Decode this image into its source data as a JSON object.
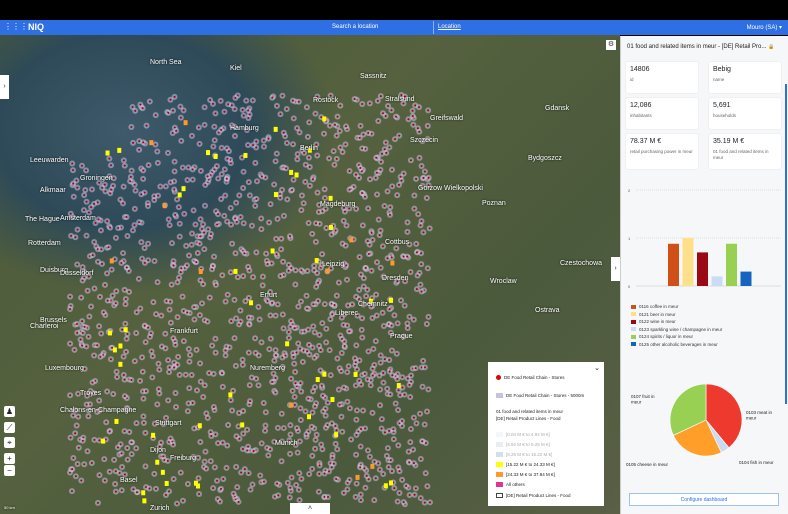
{
  "nav": {
    "app_name": "NIQ",
    "search_placeholder": "Search a location",
    "location_link": "Location",
    "user": "Mouro (SA) ▾",
    "grid_icon": "⋮⋮⋮"
  },
  "map": {
    "cities": [
      "North Sea",
      "Berlin",
      "Hamburg",
      "Rostock",
      "Gdansk",
      "Szczecin",
      "Bydgoszcz",
      "Poznan",
      "Leeuwarden",
      "Groningen",
      "Alkmaar",
      "The Hague",
      "Rotterdam",
      "Amsterdam",
      "Duisburg",
      "Dusseldorf",
      "Gorzow Wielkopolski",
      "Magdeburg",
      "Leipzig",
      "Dresden",
      "Chemnitz",
      "Wroclaw",
      "Prague",
      "Brussels",
      "Charleroi",
      "Luxembourg",
      "Frankfurt",
      "Nuremberg",
      "Stuttgart",
      "Munich",
      "Freiburg",
      "Basel",
      "Zurich",
      "Ostrava",
      "Czestochowa",
      "Liberec",
      "Erfurt",
      "Cottbus",
      "Kiel",
      "Sassnitz",
      "Stralsund",
      "Greifswald",
      "Troyes",
      "Chalons-en-Champagne",
      "Dijon"
    ],
    "controls": {
      "person": "♟",
      "ruler": "⟋",
      "locate": "⌖",
      "zoom_in": "+",
      "zoom_out": "−",
      "expand_left": "›",
      "expand_right": "›",
      "expand_bottom": "˄",
      "scale": "50 km"
    }
  },
  "legend": {
    "collapse": "⌄",
    "items": [
      {
        "label": "DE Food Retail Chain - Stores",
        "color": "#e00000"
      },
      {
        "label": "DE Food Retail Chain - Stores - 5000m",
        "color": "#c5c3dd"
      }
    ],
    "heading1": "01 food and related items in meur",
    "heading2": "[DE] Retail Product Lines - Food",
    "ranges": [
      {
        "label": "[0.04 M € to 4.92 M €]",
        "color": "#f3f6fb",
        "muted": true
      },
      {
        "label": "[4.92 M € to 9.25 M €]",
        "color": "#e6edf4",
        "muted": true
      },
      {
        "label": "[9.25 M € to 15.22 M €]",
        "color": "#cfe0ef",
        "muted": true
      },
      {
        "label": "[15.22 M € to 24.33 M €]",
        "color": "#ffff00",
        "muted": false
      },
      {
        "label": "[24.33 M € to 37.84 M €]",
        "color": "#ff9a2a",
        "muted": false
      },
      {
        "label": "All others",
        "color": "#e0339a",
        "muted": false
      }
    ],
    "footer": "[DE] Retail Product Lines - Food"
  },
  "panel": {
    "title": "01 food and related items in meur - [DE] Retail Pro...",
    "lock_icon": "🔒",
    "cards": [
      {
        "value": "14806",
        "label": "id"
      },
      {
        "value": "Bebig",
        "label": "name"
      },
      {
        "value": "12,086",
        "label": "inhabitants"
      },
      {
        "value": "5,691",
        "label": "households"
      },
      {
        "value": "78.37 M €",
        "label": "retail purchasing power in meur"
      },
      {
        "value": "35.19 M €",
        "label": "01 food and related items in meur"
      }
    ],
    "configure": "Configure dashboard"
  },
  "chart_data": [
    {
      "type": "bar",
      "ylim": [
        0,
        2
      ],
      "yticks": [
        "2",
        "1",
        "0"
      ],
      "categories": [
        "0116 coffee in meur",
        "0121 beer in meur",
        "0122 wine in meur",
        "0123 sparkling wine / champagne in meur",
        "0124 spirits / liquor in meur",
        "0125 other alcoholic beverages in meur"
      ],
      "values": [
        0.88,
        1.0,
        0.7,
        0.2,
        0.88,
        0.3
      ],
      "colors": [
        "#d05018",
        "#ffe08a",
        "#9b0a14",
        "#c9dcf2",
        "#98d054",
        "#1565c0"
      ]
    },
    {
      "type": "pie",
      "labels": [
        "0103 meat in meur",
        "0104 fish in meur",
        "0105 cheese in meur",
        "0107 fruit in meur"
      ],
      "values": [
        39,
        4,
        25,
        32
      ],
      "colors": [
        "#ee3a2e",
        "#c9dcf2",
        "#ff9f2a",
        "#98d054"
      ]
    }
  ]
}
